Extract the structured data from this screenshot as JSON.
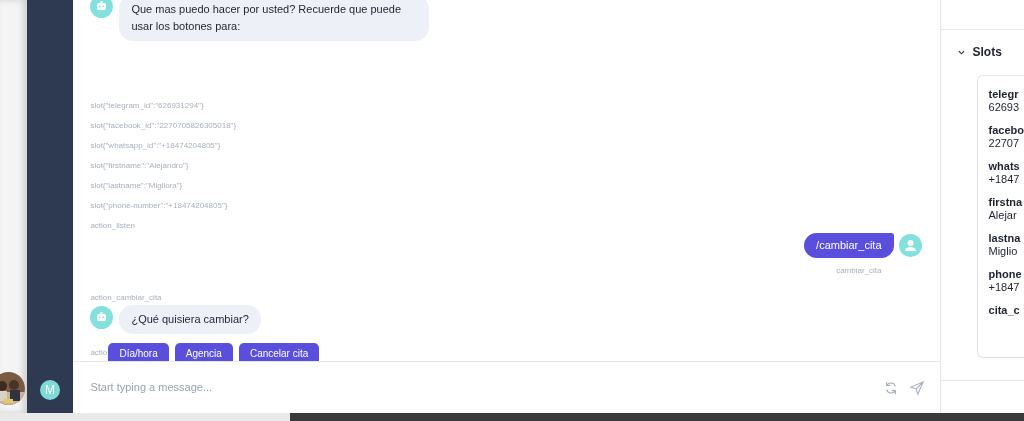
{
  "sidebar": {
    "user_initial": "M"
  },
  "messages": [
    {
      "kind": "bot",
      "text": "Que mas puedo hacer por usted? Recuerde que puede usar los botones para:"
    },
    {
      "kind": "event",
      "text": "slot{\"telegram_id\":\"626931294\"}"
    },
    {
      "kind": "event",
      "text": "slot{\"facebook_id\":\"2270705826305018\"}"
    },
    {
      "kind": "event",
      "text": "slot{\"whatsapp_id\":\"+18474204805\"}"
    },
    {
      "kind": "event",
      "text": "slot{\"firstname\":\"Alejandro\"}"
    },
    {
      "kind": "event",
      "text": "slot{\"lastname\":\"Migliora\"}"
    },
    {
      "kind": "event",
      "text": "slot{\"phone-number\":\"+18474204805\"}"
    },
    {
      "kind": "event",
      "text": "action_listen"
    },
    {
      "kind": "user",
      "text": "/cambiar_cita",
      "intent": "cambiar_cita"
    },
    {
      "kind": "event",
      "text": "action_cambiar_cita"
    },
    {
      "kind": "bot",
      "text": "¿Qué quisiera cambiar?"
    },
    {
      "kind": "buttons",
      "partly_hidden_text": "actio",
      "buttons": [
        "Día/hora",
        "Agencia",
        "Cancelar cita"
      ]
    }
  ],
  "composer": {
    "placeholder": "Start typing a message..."
  },
  "slots_panel": {
    "title": "Slots",
    "expanded": true,
    "slots": [
      {
        "name": "telegr",
        "value": "62693"
      },
      {
        "name": "facebo",
        "value": "22707"
      },
      {
        "name": "whats",
        "value": "+1847"
      },
      {
        "name": "firstna",
        "value": "Alejar"
      },
      {
        "name": "lastna",
        "value": "Miglio"
      },
      {
        "name": "phone",
        "value": "+1847"
      },
      {
        "name": "cita_c"
      }
    ]
  }
}
